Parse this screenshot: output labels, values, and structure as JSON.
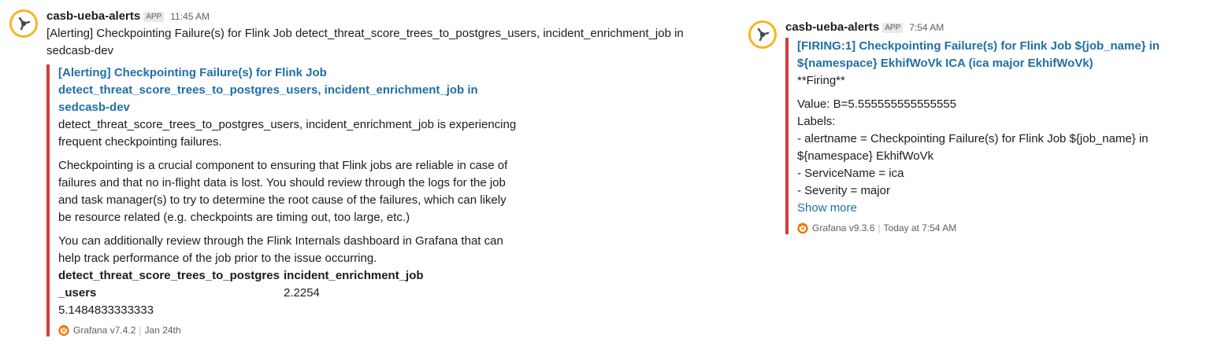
{
  "messages": [
    {
      "sender": "casb-ueba-alerts",
      "badge": "APP",
      "time": "11:45 AM",
      "text": "[Alerting] Checkpointing Failure(s) for Flink Job detect_threat_score_trees_to_postgres_users, incident_enrichment_job in sedcasb-dev",
      "attachment": {
        "title": "[Alerting] Checkpointing Failure(s) for Flink Job detect_threat_score_trees_to_postgres_users, incident_enrichment_job in sedcasb-dev",
        "paragraphs": [
          "detect_threat_score_trees_to_postgres_users, incident_enrichment_job is experiencing frequent checkpointing failures.",
          "Checkpointing is a crucial component to ensuring that Flink jobs are reliable in case of failures and that no in-flight data is lost. You should review through the logs for the job and task manager(s) to try to determine the root cause of the failures, which can likely be resource related (e.g. checkpoints are timing out, too large, etc.)",
          "You can additionally review through the Flink Internals dashboard in Grafana that can help track performance of the job prior to the issue occurring."
        ],
        "fields": [
          {
            "title": "detect_threat_score_trees_to_postgres_users",
            "value": "5.1484833333333"
          },
          {
            "title": "incident_enrichment_job",
            "value": "2.2254"
          }
        ],
        "footer": {
          "source": "Grafana v7.4.2",
          "date": "Jan 24th"
        }
      }
    },
    {
      "sender": "casb-ueba-alerts",
      "badge": "APP",
      "time": "7:54 AM",
      "attachment": {
        "title": "[FIRING:1] Checkpointing Failure(s) for Flink Job ${job_name} in ${namespace} EkhifWoVk ICA (ica major EkhifWoVk)",
        "lines": [
          "**Firing**",
          "Value: B=5.555555555555555",
          "Labels:",
          "- alertname = Checkpointing Failure(s) for Flink Job ${job_name} in ${namespace} EkhifWoVk",
          "- ServiceName = ica",
          "- Severity = major"
        ],
        "show_more": "Show more",
        "footer": {
          "source": "Grafana v9.3.6",
          "date": "Today at 7:54 AM"
        }
      }
    }
  ],
  "colors": {
    "attachment_bar": "#d63b3b",
    "link": "#1f6fa8",
    "avatar_ring": "#f2b623"
  },
  "icons": [
    "bot-avatar-icon",
    "grafana-logo-icon"
  ]
}
